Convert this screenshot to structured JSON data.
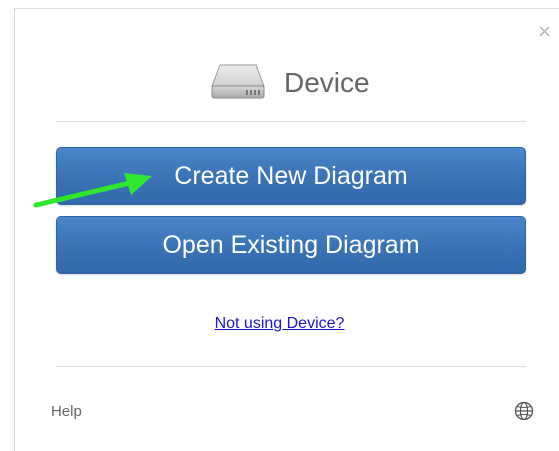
{
  "dialog": {
    "title": "Device",
    "close_label": "×",
    "create_button_label": "Create New Diagram",
    "open_button_label": "Open Existing Diagram",
    "not_using_link": "Not using Device?",
    "help_label": "Help"
  },
  "icons": {
    "device": "hard-drive-icon",
    "close": "close-icon",
    "language": "globe-icon",
    "annotation": "arrow-annotation"
  },
  "colors": {
    "button_blue": "#3a72b5",
    "link_blue": "#1a16c8",
    "annotation_green": "#2ee82e"
  }
}
